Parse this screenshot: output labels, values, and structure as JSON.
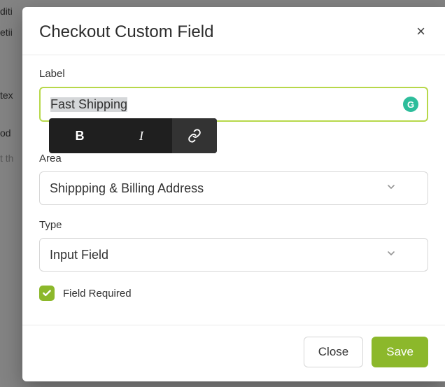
{
  "background": {
    "frag1": "diti",
    "frag2": "etii",
    "frag3": "tex",
    "frag4": "od",
    "frag5": "t th"
  },
  "modal": {
    "title": "Checkout Custom Field",
    "close_glyph": "×",
    "label_field": {
      "label": "Label",
      "value": "Fast Shipping",
      "grammarly_glyph": "G"
    },
    "toolbar": {
      "bold": "B",
      "italic": "I"
    },
    "area_field": {
      "label": "Area",
      "value": "Shippping & Billing Address"
    },
    "type_field": {
      "label": "Type",
      "value": "Input Field"
    },
    "required": {
      "checked": true,
      "label": "Field Required"
    },
    "footer": {
      "close": "Close",
      "save": "Save"
    }
  }
}
